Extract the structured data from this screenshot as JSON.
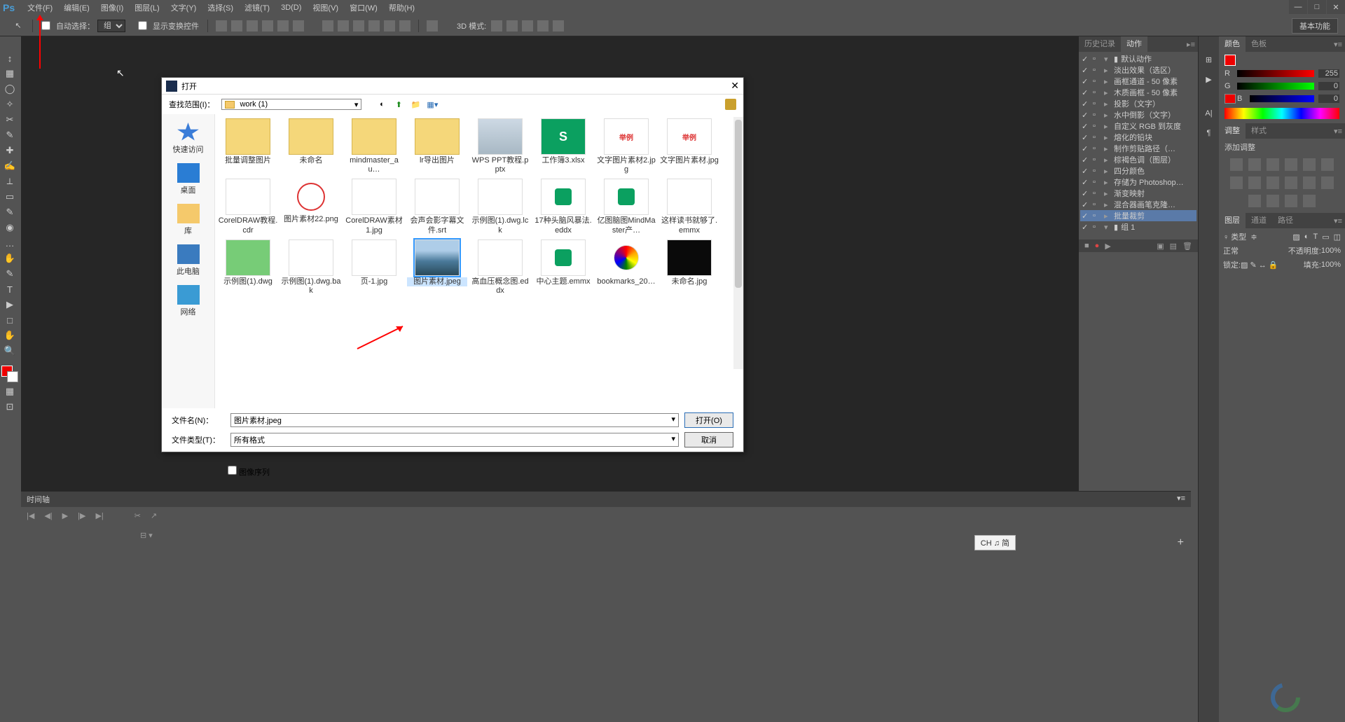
{
  "menubar": {
    "logo": "Ps",
    "items": [
      "文件(F)",
      "编辑(E)",
      "图像(I)",
      "图层(L)",
      "文字(Y)",
      "选择(S)",
      "滤镜(T)",
      "3D(D)",
      "视图(V)",
      "窗口(W)",
      "帮助(H)"
    ]
  },
  "window_controls": {
    "min": "—",
    "max": "□",
    "close": "✕"
  },
  "options": {
    "auto_select_label": "自动选择：",
    "auto_select_value": "组",
    "show_transform": "显示变换控件",
    "mode3d_label": "3D 模式:",
    "workspace": "基本功能"
  },
  "toolbox": [
    "↕",
    "▦",
    "◯",
    "✧",
    "✂",
    "✎",
    "✚",
    "✍",
    "⟂",
    "▭",
    "✎",
    "◉",
    "…",
    "✋",
    "T",
    "▶",
    "□",
    "✋",
    "🔍"
  ],
  "timeline": {
    "title": "时间轴",
    "ime": "CH ♫ 简"
  },
  "actions_panel": {
    "tabs": [
      "历史记录",
      "动作"
    ],
    "items": [
      {
        "folder": true,
        "label": "默认动作"
      },
      {
        "label": "淡出效果（选区）"
      },
      {
        "label": "画框通道 - 50 像素"
      },
      {
        "label": "木质画框 - 50 像素"
      },
      {
        "label": "投影（文字）"
      },
      {
        "label": "水中倒影（文字）"
      },
      {
        "label": "自定义 RGB 到灰度"
      },
      {
        "label": "熔化的铅块"
      },
      {
        "label": "制作剪贴路径（…"
      },
      {
        "label": "棕褐色调（图层）"
      },
      {
        "label": "四分颜色"
      },
      {
        "label": "存储为 Photoshop…"
      },
      {
        "label": "渐变映射"
      },
      {
        "label": "混合器画笔克隆…"
      },
      {
        "label": "批量裁剪",
        "selected": true
      },
      {
        "folder": true,
        "label": "组 1"
      }
    ]
  },
  "color_panel": {
    "tabs": [
      "颜色",
      "色板"
    ],
    "r": {
      "label": "R",
      "value": "255"
    },
    "g": {
      "label": "G",
      "value": "0"
    },
    "b": {
      "label": "B",
      "value": "0"
    }
  },
  "adjust_panel": {
    "tabs": [
      "调整",
      "样式"
    ],
    "subtitle": "添加调整"
  },
  "layers_panel": {
    "tabs": [
      "图层",
      "通道",
      "路径"
    ],
    "kind_label": "♀ 类型",
    "blend": "正常",
    "opacity_label": "不透明度:",
    "opacity_value": "100%",
    "lock_label": "锁定:",
    "fill_label": "填充:",
    "fill_value": "100%"
  },
  "dialog": {
    "title": "打开",
    "lookup_label": "查找范围(I)：",
    "path": "work (1)",
    "places": [
      {
        "id": "quick",
        "label": "快速访问"
      },
      {
        "id": "desktop",
        "label": "桌面"
      },
      {
        "id": "lib",
        "label": "库"
      },
      {
        "id": "pc",
        "label": "此电脑"
      },
      {
        "id": "net",
        "label": "网络"
      }
    ],
    "files": [
      {
        "name": "批量调整图片",
        "type": "folder"
      },
      {
        "name": "未命名",
        "type": "folder"
      },
      {
        "name": "mindmaster_au…",
        "type": "folder"
      },
      {
        "name": "lr导出图片",
        "type": "folder"
      },
      {
        "name": "WPS PPT教程.pptx",
        "type": "bluesky"
      },
      {
        "name": "工作簿3.xlsx",
        "type": "green",
        "glyph": "S"
      },
      {
        "name": "文字图片素材2.jpg",
        "type": "text-red",
        "glyph": "举例"
      },
      {
        "name": "文字图片素材.jpg",
        "type": "text-red",
        "glyph": "举例"
      },
      {
        "name": "CorelDRAW教程.cdr",
        "type": "blank"
      },
      {
        "name": "图片素材22.png",
        "type": "logo-red"
      },
      {
        "name": "CorelDRAW素材1.jpg",
        "type": "blank"
      },
      {
        "name": "会声会影字幕文件.srt",
        "type": "blank"
      },
      {
        "name": "示例图(1).dwg.lck",
        "type": "blank"
      },
      {
        "name": "17种头脑风暴法.eddx",
        "type": "mind"
      },
      {
        "name": "亿图脑图MindMaster产…",
        "type": "mind"
      },
      {
        "name": "这样读书就够了.emmx",
        "type": "blank"
      },
      {
        "name": "示例图(1).dwg",
        "type": "chart"
      },
      {
        "name": "示例图(1).dwg.bak",
        "type": "blank"
      },
      {
        "name": "页-1.jpg",
        "type": "blank"
      },
      {
        "name": "图片素材.jpeg",
        "type": "selected-img",
        "selected": true
      },
      {
        "name": "高血压概念图.eddx",
        "type": "blank"
      },
      {
        "name": "中心主题.emmx",
        "type": "mind"
      },
      {
        "name": "bookmarks_20…",
        "type": "colorwheel"
      },
      {
        "name": "未命名.jpg",
        "type": "dark"
      }
    ],
    "filename_label": "文件名(N)：",
    "filename_value": "图片素材.jpeg",
    "filetype_label": "文件类型(T)：",
    "filetype_value": "所有格式",
    "open_btn": "打开(O)",
    "cancel_btn": "取消",
    "sequence_chk": "图像序列"
  }
}
